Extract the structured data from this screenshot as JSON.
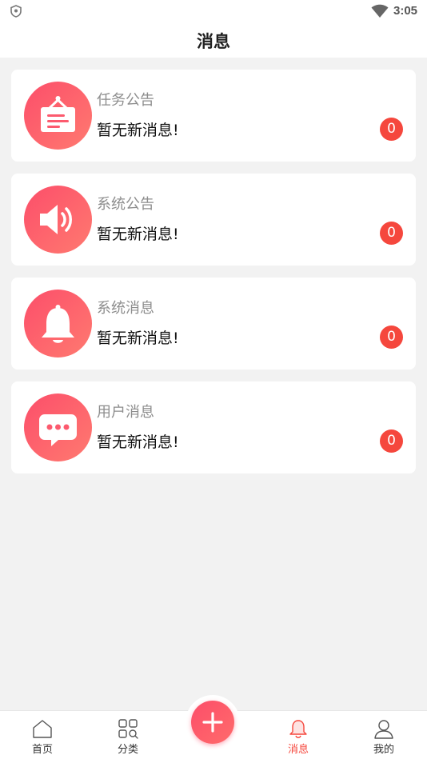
{
  "status_bar": {
    "time": "3:05"
  },
  "header": {
    "title": "消息"
  },
  "messages": [
    {
      "title": "任务公告",
      "message": "暂无新消息!",
      "count": "0",
      "icon": "announcement-board-icon"
    },
    {
      "title": "系统公告",
      "message": "暂无新消息!",
      "count": "0",
      "icon": "speaker-icon"
    },
    {
      "title": "系统消息",
      "message": "暂无新消息!",
      "count": "0",
      "icon": "bell-icon"
    },
    {
      "title": "用户消息",
      "message": "暂无新消息!",
      "count": "0",
      "icon": "chat-bubble-icon"
    }
  ],
  "tab_bar": {
    "items": [
      {
        "label": "首页",
        "icon": "home-icon"
      },
      {
        "label": "分类",
        "icon": "category-grid-icon"
      },
      {
        "label": "消息",
        "icon": "bell-icon",
        "active": true
      },
      {
        "label": "我的",
        "icon": "user-icon"
      }
    ],
    "center_button_icon": "plus-icon"
  },
  "colors": {
    "accent": "#f5473d",
    "icon_gradient_start": "#fc4e6a",
    "icon_gradient_end": "#ff7a70",
    "background": "#f2f2f2"
  }
}
